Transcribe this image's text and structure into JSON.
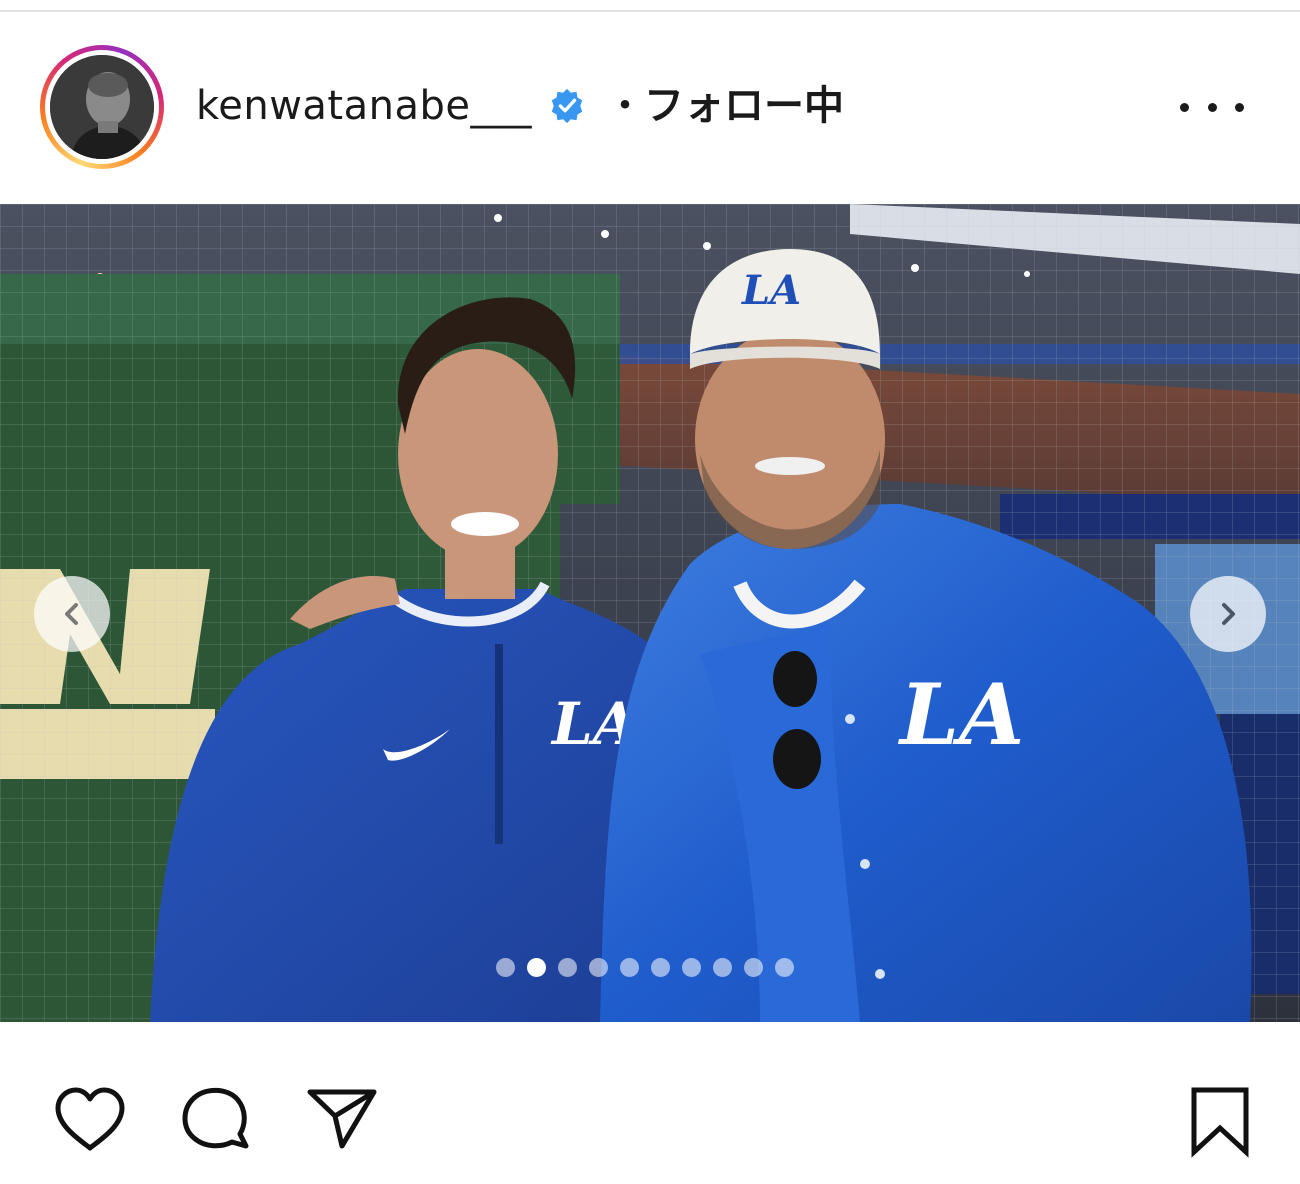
{
  "post": {
    "author": {
      "username": "kenwatanabe___",
      "verified": true,
      "separator": "・",
      "follow_status": "フォロー中"
    },
    "media": {
      "carousel": {
        "total_slides": 10,
        "active_index": 1
      }
    },
    "accent_colors": {
      "verified_badge": "#3897f0",
      "text": "#1a1a1a"
    },
    "icons": {
      "more": "more-horizontal-icon",
      "like": "heart-icon",
      "comment": "comment-bubble-icon",
      "share": "paper-plane-icon",
      "save": "bookmark-icon",
      "prev": "chevron-left-icon",
      "next": "chevron-right-icon"
    }
  }
}
